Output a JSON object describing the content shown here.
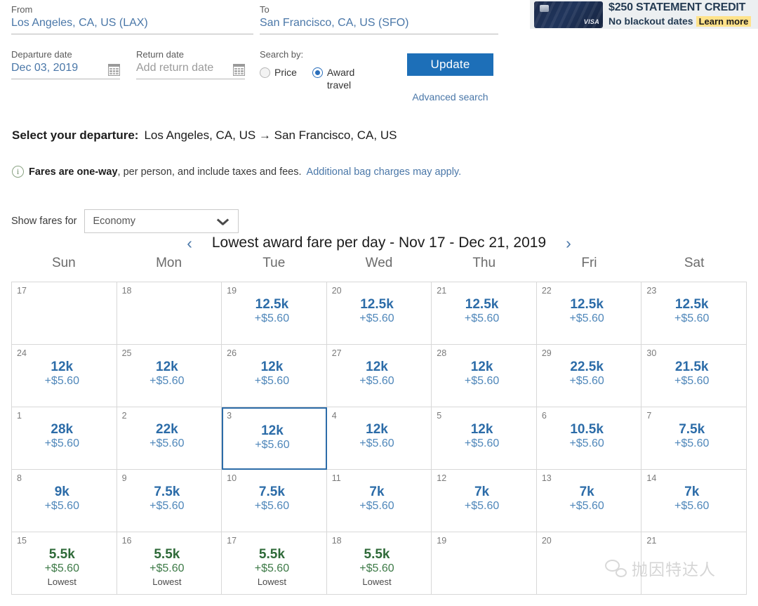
{
  "search": {
    "from_label": "From",
    "from_value": "Los Angeles, CA, US (LAX)",
    "to_label": "To",
    "to_value": "San Francisco, CA, US (SFO)",
    "departure_label": "Departure date",
    "departure_value": "Dec 03, 2019",
    "return_label": "Return date",
    "return_placeholder": "Add return date",
    "search_by_label": "Search by:",
    "option_price": "Price",
    "option_award": "Award travel",
    "selected_option": "Award travel",
    "update_button": "Update",
    "advanced_search": "Advanced search"
  },
  "ad": {
    "line1": "$250 STATEMENT CREDIT",
    "line2": "No blackout dates",
    "cta": "Learn more",
    "card_brand": "VISA"
  },
  "departure": {
    "heading": "Select your departure:",
    "route": "Los Angeles, CA, US → San Francisco, CA, US",
    "note_bold": "Fares are one-way",
    "note_rest": ", per person, and include taxes and fees.",
    "note_link": "Additional bag charges may apply."
  },
  "fares_filter": {
    "label": "Show fares for",
    "selected": "Economy"
  },
  "calendar": {
    "title": "Lowest award fare per day - Nov 17 - Dec 21, 2019",
    "prev_arrow": "‹",
    "next_arrow": "›",
    "weekdays": [
      "Sun",
      "Mon",
      "Tue",
      "Wed",
      "Thu",
      "Fri",
      "Sat"
    ],
    "selected_day": 3,
    "lowest_label": "Lowest",
    "cells": [
      {
        "day": "17",
        "miles": "",
        "tax": "",
        "note": "",
        "state": "empty"
      },
      {
        "day": "18",
        "miles": "",
        "tax": "",
        "note": "",
        "state": "empty"
      },
      {
        "day": "19",
        "miles": "12.5k",
        "tax": "+$5.60",
        "note": "",
        "state": "normal"
      },
      {
        "day": "20",
        "miles": "12.5k",
        "tax": "+$5.60",
        "note": "",
        "state": "normal"
      },
      {
        "day": "21",
        "miles": "12.5k",
        "tax": "+$5.60",
        "note": "",
        "state": "normal"
      },
      {
        "day": "22",
        "miles": "12.5k",
        "tax": "+$5.60",
        "note": "",
        "state": "normal"
      },
      {
        "day": "23",
        "miles": "12.5k",
        "tax": "+$5.60",
        "note": "",
        "state": "normal"
      },
      {
        "day": "24",
        "miles": "12k",
        "tax": "+$5.60",
        "note": "",
        "state": "normal"
      },
      {
        "day": "25",
        "miles": "12k",
        "tax": "+$5.60",
        "note": "",
        "state": "normal"
      },
      {
        "day": "26",
        "miles": "12k",
        "tax": "+$5.60",
        "note": "",
        "state": "normal"
      },
      {
        "day": "27",
        "miles": "12k",
        "tax": "+$5.60",
        "note": "",
        "state": "normal"
      },
      {
        "day": "28",
        "miles": "12k",
        "tax": "+$5.60",
        "note": "",
        "state": "normal"
      },
      {
        "day": "29",
        "miles": "22.5k",
        "tax": "+$5.60",
        "note": "",
        "state": "normal"
      },
      {
        "day": "30",
        "miles": "21.5k",
        "tax": "+$5.60",
        "note": "",
        "state": "normal"
      },
      {
        "day": "1",
        "miles": "28k",
        "tax": "+$5.60",
        "note": "",
        "state": "normal"
      },
      {
        "day": "2",
        "miles": "22k",
        "tax": "+$5.60",
        "note": "",
        "state": "normal"
      },
      {
        "day": "3",
        "miles": "12k",
        "tax": "+$5.60",
        "note": "",
        "state": "selected"
      },
      {
        "day": "4",
        "miles": "12k",
        "tax": "+$5.60",
        "note": "",
        "state": "normal"
      },
      {
        "day": "5",
        "miles": "12k",
        "tax": "+$5.60",
        "note": "",
        "state": "normal"
      },
      {
        "day": "6",
        "miles": "10.5k",
        "tax": "+$5.60",
        "note": "",
        "state": "normal"
      },
      {
        "day": "7",
        "miles": "7.5k",
        "tax": "+$5.60",
        "note": "",
        "state": "normal"
      },
      {
        "day": "8",
        "miles": "9k",
        "tax": "+$5.60",
        "note": "",
        "state": "normal"
      },
      {
        "day": "9",
        "miles": "7.5k",
        "tax": "+$5.60",
        "note": "",
        "state": "normal"
      },
      {
        "day": "10",
        "miles": "7.5k",
        "tax": "+$5.60",
        "note": "",
        "state": "normal"
      },
      {
        "day": "11",
        "miles": "7k",
        "tax": "+$5.60",
        "note": "",
        "state": "normal"
      },
      {
        "day": "12",
        "miles": "7k",
        "tax": "+$5.60",
        "note": "",
        "state": "normal"
      },
      {
        "day": "13",
        "miles": "7k",
        "tax": "+$5.60",
        "note": "",
        "state": "normal"
      },
      {
        "day": "14",
        "miles": "7k",
        "tax": "+$5.60",
        "note": "",
        "state": "normal"
      },
      {
        "day": "15",
        "miles": "5.5k",
        "tax": "+$5.60",
        "note": "Lowest",
        "state": "lowest"
      },
      {
        "day": "16",
        "miles": "5.5k",
        "tax": "+$5.60",
        "note": "Lowest",
        "state": "lowest"
      },
      {
        "day": "17",
        "miles": "5.5k",
        "tax": "+$5.60",
        "note": "Lowest",
        "state": "lowest"
      },
      {
        "day": "18",
        "miles": "5.5k",
        "tax": "+$5.60",
        "note": "Lowest",
        "state": "lowest"
      },
      {
        "day": "19",
        "miles": "",
        "tax": "",
        "note": "",
        "state": "empty"
      },
      {
        "day": "20",
        "miles": "",
        "tax": "",
        "note": "",
        "state": "empty"
      },
      {
        "day": "21",
        "miles": "",
        "tax": "",
        "note": "",
        "state": "empty"
      }
    ]
  },
  "watermark": {
    "text": "抛因特达人"
  },
  "colors": {
    "accent_blue": "#2c6ca8",
    "button_blue": "#1d6fb8",
    "link_blue": "#4a77a8",
    "lowest_green": "#2f6a39",
    "highlight_yellow": "#ffe28a"
  }
}
